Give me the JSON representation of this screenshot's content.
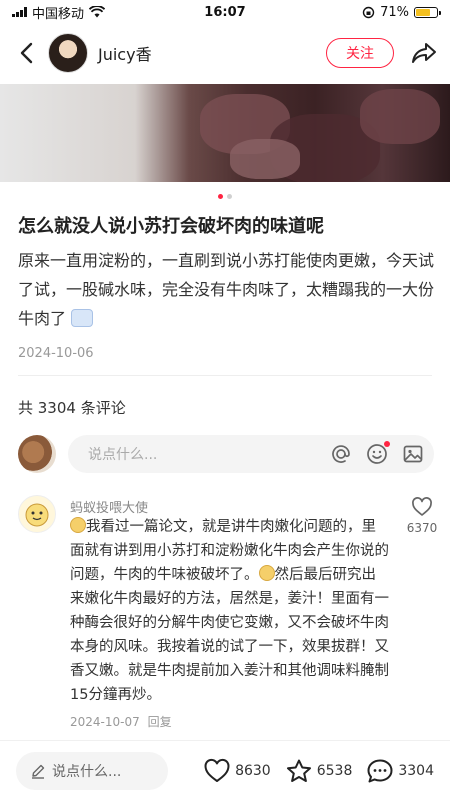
{
  "status_bar": {
    "carrier": "中国移动",
    "time": "16:07",
    "battery": "71%",
    "battery_level": 0.71
  },
  "header": {
    "username": "Juicy香",
    "follow_label": "关注"
  },
  "post": {
    "image_count": 2,
    "image_index": 1,
    "title": "怎么就没人说小苏打会破坏肉的味道呢",
    "body": "原来一直用淀粉的，一直刷到说小苏打能使肉更嫩，今天试了试，一股碱水味，完全没有牛肉味了，太糟蹋我的一大份牛肉了",
    "date": "2024-10-06"
  },
  "comments": {
    "count_label": "共 3304 条评论",
    "input_placeholder": "说点什么...",
    "items": [
      {
        "author": "蚂蚁投喂大使",
        "text_1": "我看过一篇论文，就是讲牛肉嫩化问题的，里面就有讲到用小苏打和淀粉嫩化牛肉会产生你说的问题，牛肉的牛味被破坏了。",
        "text_2": "然后最后研究出来嫩化牛肉最好的方法，居然是，姜汁！里面有一种酶会很好的分解牛肉使它变嫩，又不会破坏牛肉本身的风味。我按着说的试了一下，效果拔群！又香又嫩。就是牛肉提前加入姜汁和其他调味料腌制15分鐘再炒。",
        "date": "2024-10-07",
        "reply_label": "回复",
        "likes": "6370"
      }
    ]
  },
  "bottom_bar": {
    "input_placeholder": "说点什么...",
    "likes": "8630",
    "favorites": "6538",
    "comments": "3304"
  },
  "colors": {
    "accent": "#ff2442",
    "text": "#222222",
    "muted": "#999999"
  },
  "icons": [
    "wifi-icon",
    "back-icon",
    "share-icon",
    "at-icon",
    "emoji-icon",
    "image-icon",
    "heart-icon",
    "star-icon",
    "comment-icon",
    "pencil-icon"
  ]
}
